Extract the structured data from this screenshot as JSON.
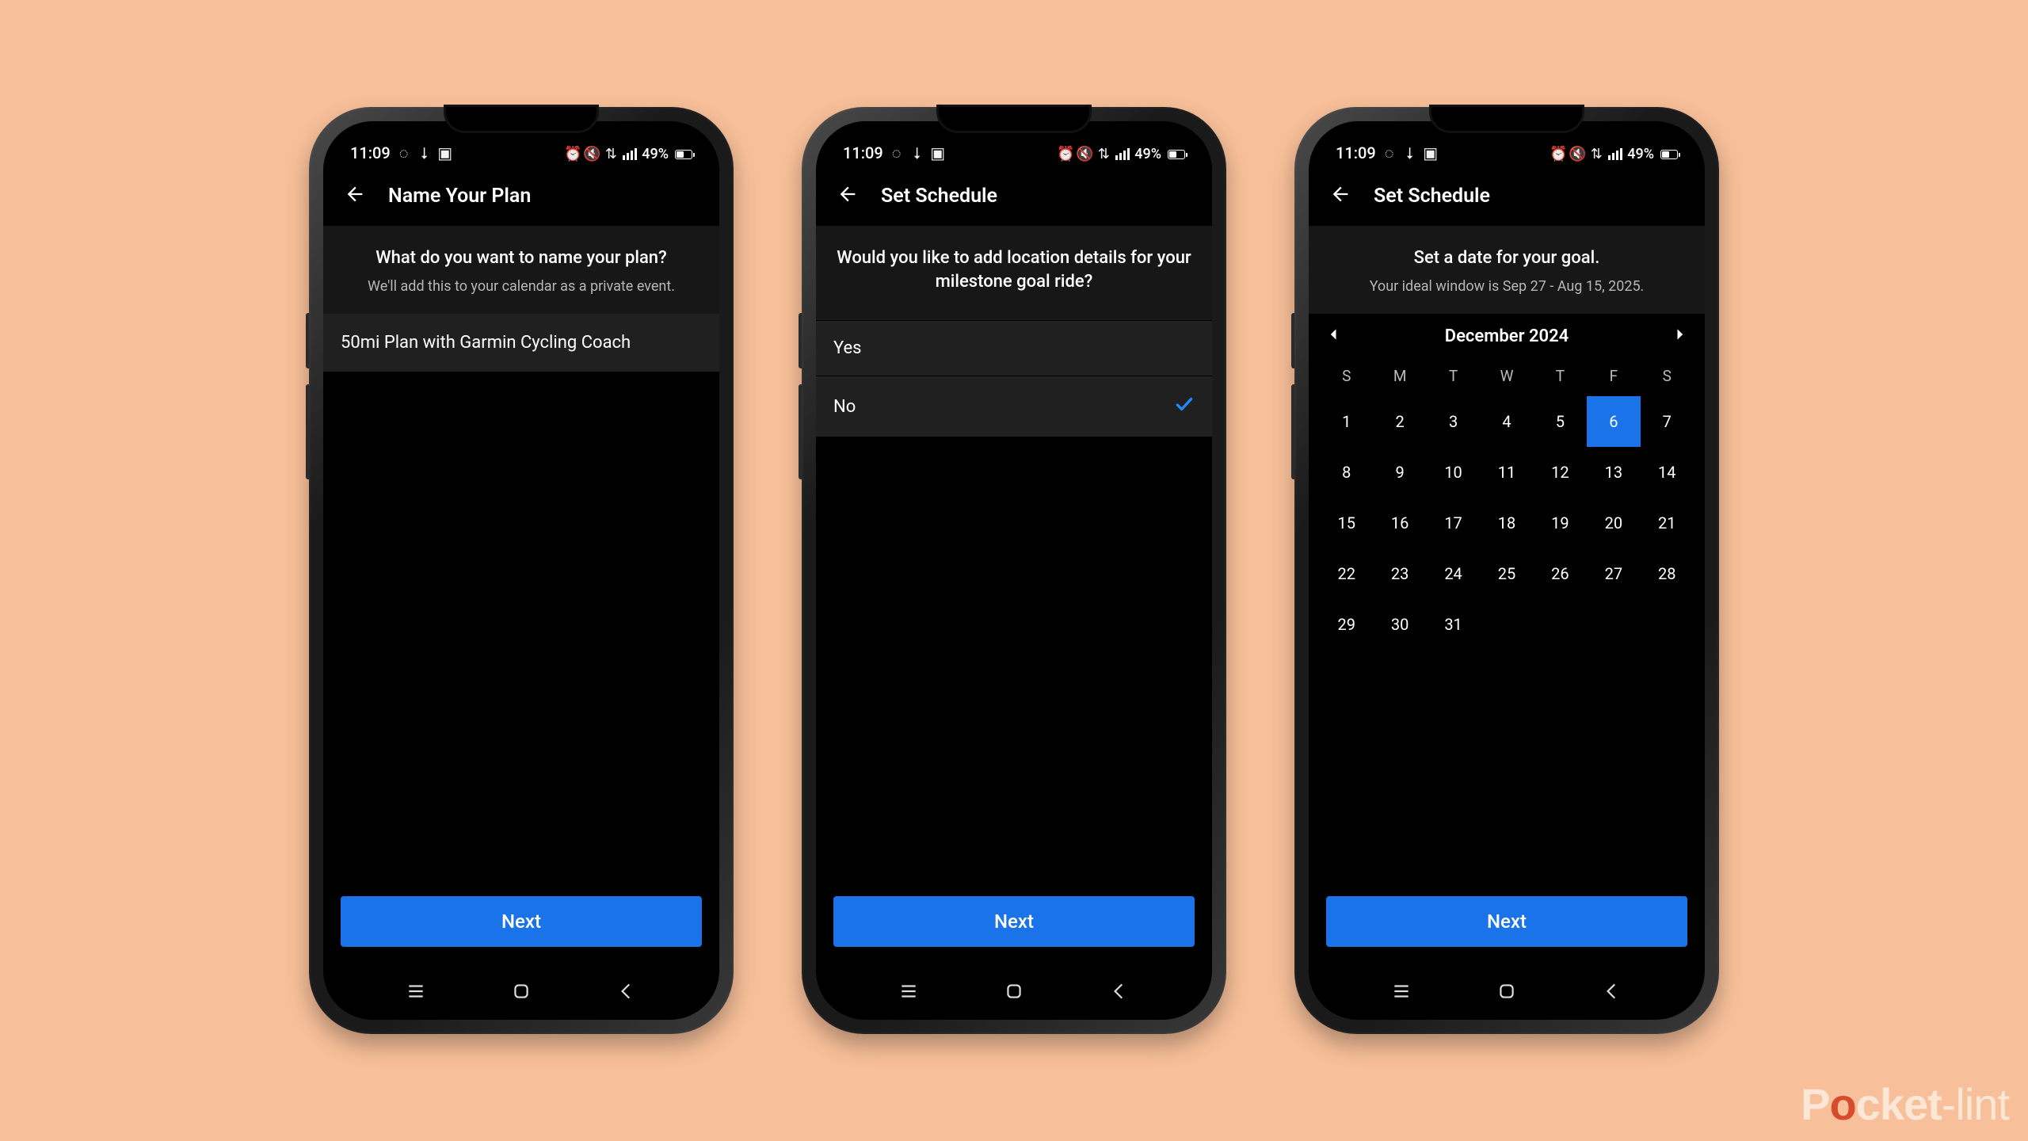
{
  "status": {
    "time": "11:09",
    "battery": "49%"
  },
  "watermark": {
    "brand_pre": "P",
    "brand_o": "o",
    "brand_post": "cket",
    "brand_thin": "-lint"
  },
  "phones": [
    {
      "header_title": "Name Your Plan",
      "prompt_title": "What do you want to name your plan?",
      "prompt_sub": "We'll add this to your calendar as a private event.",
      "input_value": "50mi Plan with Garmin Cycling Coach",
      "next_label": "Next"
    },
    {
      "header_title": "Set Schedule",
      "prompt_title": "Would you like to add location details for your milestone goal ride?",
      "options": {
        "yes": "Yes",
        "no": "No"
      },
      "selected": "no",
      "next_label": "Next"
    },
    {
      "header_title": "Set Schedule",
      "prompt_title": "Set a date for your goal.",
      "prompt_sub": "Your ideal window is Sep 27 - Aug 15, 2025.",
      "calendar": {
        "month_label": "December 2024",
        "dow": [
          "S",
          "M",
          "T",
          "W",
          "T",
          "F",
          "S"
        ],
        "weeks": [
          [
            "1",
            "2",
            "3",
            "4",
            "5",
            "6",
            "7"
          ],
          [
            "8",
            "9",
            "10",
            "11",
            "12",
            "13",
            "14"
          ],
          [
            "15",
            "16",
            "17",
            "18",
            "19",
            "20",
            "21"
          ],
          [
            "22",
            "23",
            "24",
            "25",
            "26",
            "27",
            "28"
          ],
          [
            "29",
            "30",
            "31",
            "",
            "",
            "",
            ""
          ]
        ],
        "selected_day": "6"
      },
      "next_label": "Next"
    }
  ]
}
